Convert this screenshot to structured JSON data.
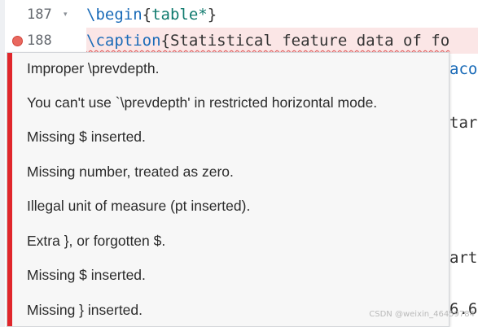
{
  "editor": {
    "lines": [
      {
        "number": "187",
        "fold": "▾",
        "has_error": false
      },
      {
        "number": "188",
        "fold": "",
        "has_error": true
      }
    ],
    "line187": {
      "cmd": "\\begin",
      "open": "{",
      "arg": "table*",
      "close": "}"
    },
    "line188": {
      "cmd": "\\caption",
      "open": "{",
      "text": "Statistical feature data of fo"
    }
  },
  "peek_text": [
    "aco",
    "tar",
    "art",
    "6.6"
  ],
  "error_popup": {
    "accent_color": "#e0262b",
    "messages": [
      "Improper \\prevdepth.",
      "You can't use `\\prevdepth' in restricted horizontal mode.",
      "Missing $ inserted.",
      "Missing number, treated as zero.",
      "Illegal unit of measure (pt inserted).",
      "Extra }, or forgotten $.",
      "Missing $ inserted.",
      "Missing } inserted."
    ]
  },
  "watermark": "CSDN @weixin_46459784"
}
